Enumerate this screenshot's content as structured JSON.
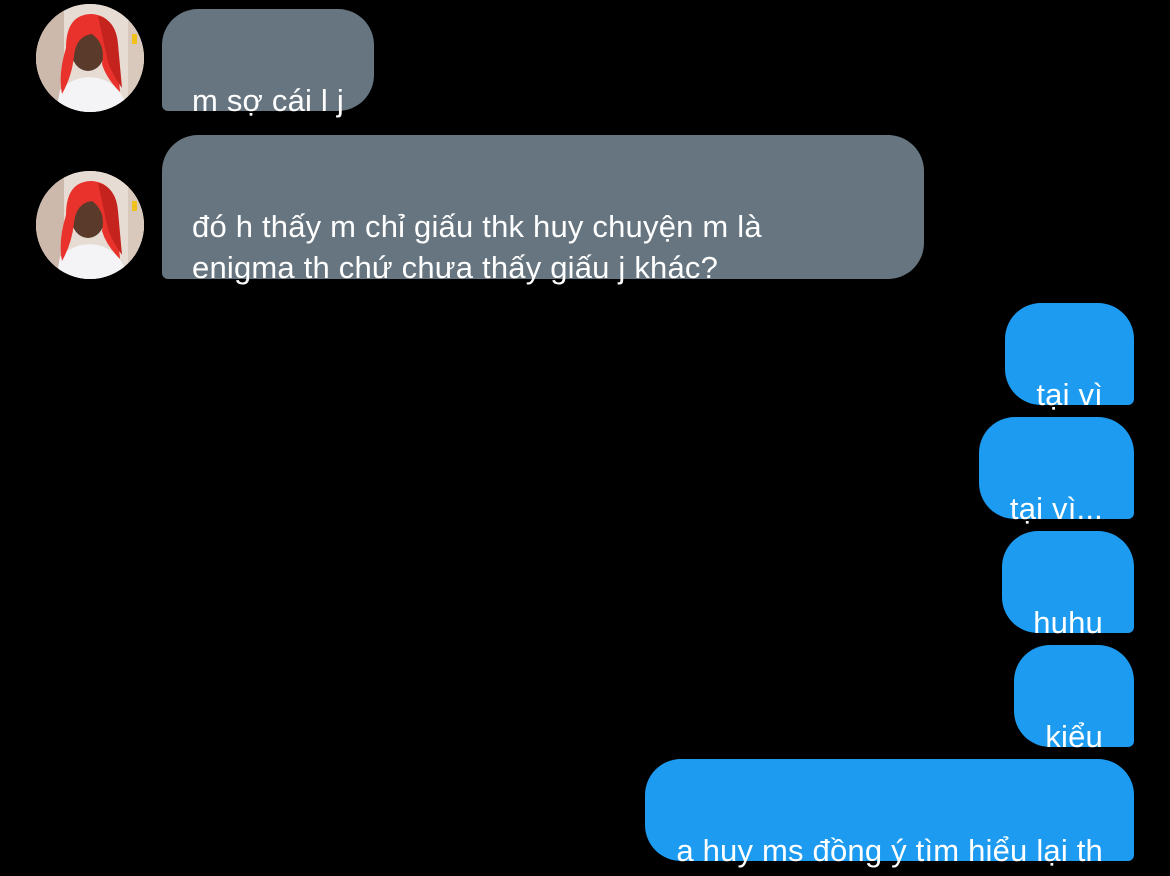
{
  "conversation": {
    "messages": [
      {
        "direction": "incoming",
        "text": "m sợ cái l j"
      },
      {
        "direction": "incoming",
        "text": "đó h thấy m chỉ giấu thk huy chuyện m là\nenigma th chứ chưa thấy giấu j khác?"
      },
      {
        "direction": "outgoing",
        "text": "tại vì"
      },
      {
        "direction": "outgoing",
        "text": "tại vì..."
      },
      {
        "direction": "outgoing",
        "text": "huhu"
      },
      {
        "direction": "outgoing",
        "text": "kiểu"
      },
      {
        "direction": "outgoing",
        "text": "a huy ms đồng ý tìm hiểu lại th"
      }
    ]
  },
  "colors": {
    "background": "#000000",
    "incoming_bubble": "#66757f",
    "outgoing_bubble": "#1d9bf0",
    "text": "#ffffff"
  },
  "icons": {
    "avatar": "contact-avatar-red-headscarf"
  }
}
